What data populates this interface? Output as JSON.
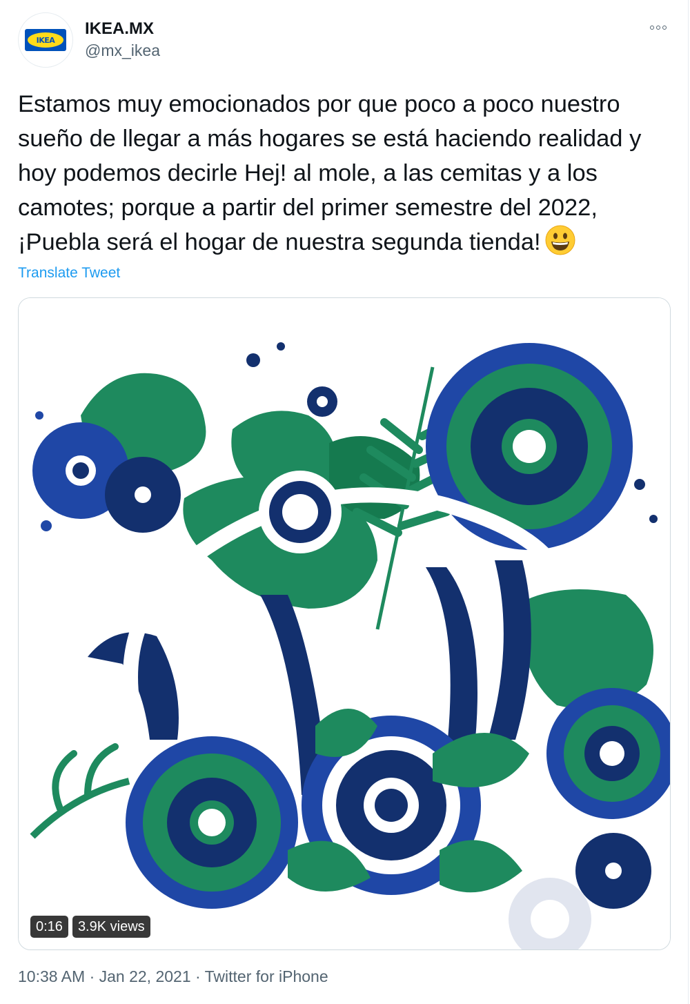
{
  "account": {
    "display_name": "IKEA.MX",
    "handle": "@mx_ikea",
    "logo_text": "IKEA"
  },
  "tweet": {
    "text": "Estamos muy emocionados por que poco a poco nuestro sueño de llegar a más hogares se está haciendo realidad y hoy podemos decirle Hej! al mole, a las cemitas y a los camotes; porque a partir del primer semestre del 2022, ¡Puebla será el hogar de nuestra segunda tienda!",
    "emoji": "grinning-face",
    "translate_label": "Translate Tweet"
  },
  "video": {
    "duration": "0:16",
    "views": "3.9K views"
  },
  "meta": {
    "line": "10:38 AM · Jan 22, 2021 · Twitter for iPhone"
  },
  "colors": {
    "link": "#1d9bf0",
    "navy": "#13306e",
    "royal": "#1f47a6",
    "green": "#1e8a5e",
    "dark_green": "#157a4f"
  },
  "icons": {
    "more": "more-options-icon"
  }
}
